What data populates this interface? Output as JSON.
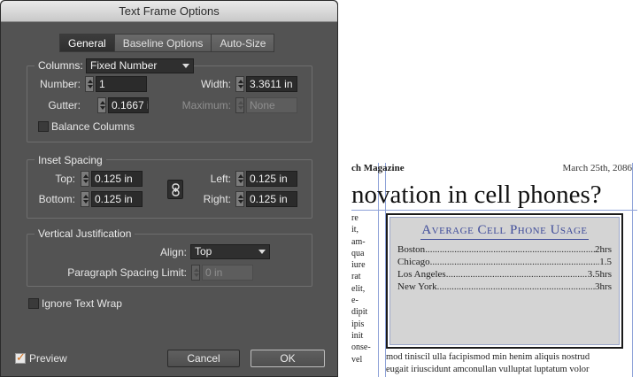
{
  "dialog": {
    "title": "Text Frame Options",
    "tabs": [
      {
        "label": "General",
        "active": true
      },
      {
        "label": "Baseline Options",
        "active": false
      },
      {
        "label": "Auto-Size",
        "active": false
      }
    ],
    "columns": {
      "label": "Columns:",
      "type_value": "Fixed Number",
      "number_label": "Number:",
      "number_value": "1",
      "width_label": "Width:",
      "width_value": "3.3611 in",
      "gutter_label": "Gutter:",
      "gutter_value": "0.1667 in",
      "maximum_label": "Maximum:",
      "maximum_value": "None",
      "balance_label": "Balance Columns",
      "balance_checked": false
    },
    "inset": {
      "legend": "Inset Spacing",
      "top_label": "Top:",
      "top_value": "0.125 in",
      "bottom_label": "Bottom:",
      "bottom_value": "0.125 in",
      "left_label": "Left:",
      "left_value": "0.125 in",
      "right_label": "Right:",
      "right_value": "0.125 in",
      "link_icon": "chain-link-icon"
    },
    "vertical": {
      "legend": "Vertical Justification",
      "align_label": "Align:",
      "align_value": "Top",
      "spacing_label": "Paragraph Spacing Limit:",
      "spacing_value": "0 in"
    },
    "ignore_wrap_label": "Ignore Text Wrap",
    "ignore_wrap_checked": false,
    "preview_label": "Preview",
    "preview_checked": true,
    "cancel_label": "Cancel",
    "ok_label": "OK"
  },
  "document": {
    "masthead_left": "ch Magazine",
    "masthead_right": "March 25th, 2086",
    "headline": "novation in cell phones?",
    "left_column_lines": [
      "re",
      "it,",
      "am-",
      "qua",
      "iure",
      "rat",
      "elit,",
      "e-",
      "dipit",
      "ipis",
      "init",
      "onse-",
      "vel"
    ],
    "sidebar": {
      "title": "Average Cell Phone Usage",
      "rows": [
        {
          "city": "Boston",
          "value": "2hrs"
        },
        {
          "city": "Chicago",
          "value": "1.5"
        },
        {
          "city": "Los Angeles",
          "value": "3.5hrs"
        },
        {
          "city": "New York",
          "value": "3hrs"
        }
      ]
    },
    "bottom_lines": [
      "mod tiniscil ulla facipismod min henim aliquis nostrud",
      "eugait iriuscidunt amconullan vulluptat luptatum volor"
    ]
  },
  "colors": {
    "dialog_bg": "#535353",
    "field_bg": "#2b2b2b",
    "sidebar_title": "#3f4c9a",
    "sidebar_bg": "#d4d4d4",
    "guide": "#8ea2d8",
    "checkmark": "#d4701a"
  }
}
